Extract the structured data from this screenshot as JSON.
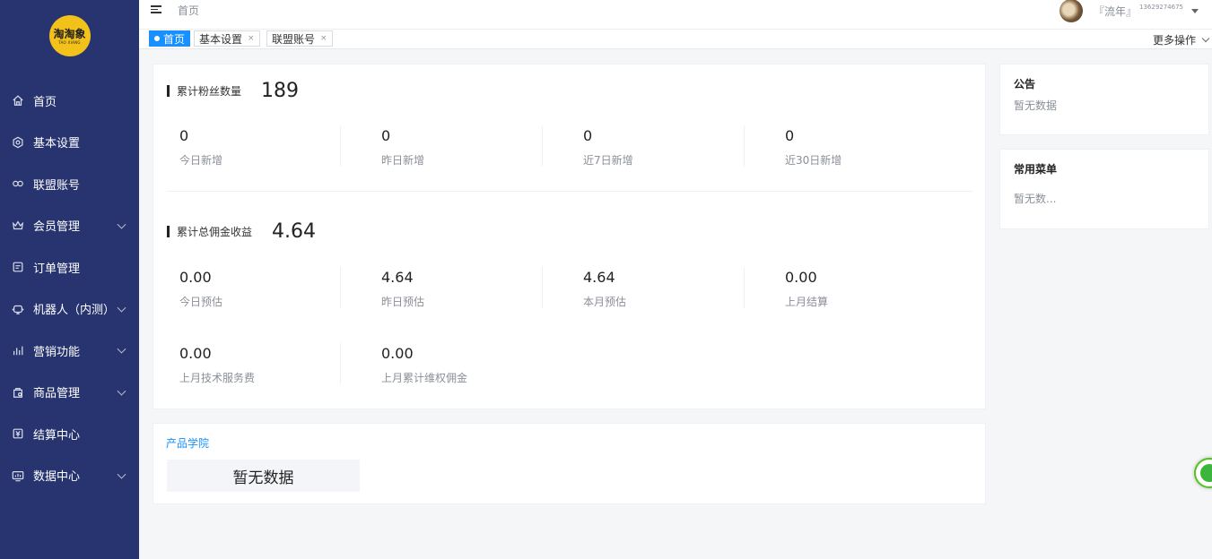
{
  "brand": {
    "logo_text": "淘淘象",
    "logo_sub": "TAO XIANG"
  },
  "sidebar": {
    "items": [
      {
        "label": "首页",
        "icon": "home-icon",
        "has_submenu": false
      },
      {
        "label": "基本设置",
        "icon": "settings-icon",
        "has_submenu": false
      },
      {
        "label": "联盟账号",
        "icon": "link-icon",
        "has_submenu": false
      },
      {
        "label": "会员管理",
        "icon": "crown-icon",
        "has_submenu": true
      },
      {
        "label": "订单管理",
        "icon": "order-icon",
        "has_submenu": false
      },
      {
        "label": "机器人（内测）",
        "icon": "robot-icon",
        "has_submenu": true
      },
      {
        "label": "营销功能",
        "icon": "chart-icon",
        "has_submenu": true
      },
      {
        "label": "商品管理",
        "icon": "goods-icon",
        "has_submenu": true
      },
      {
        "label": "结算中心",
        "icon": "settlement-icon",
        "has_submenu": false
      },
      {
        "label": "数据中心",
        "icon": "monitor-icon",
        "has_submenu": true
      }
    ],
    "colors": {
      "background": "#27346f",
      "text": "#ffffff"
    }
  },
  "topbar": {
    "breadcrumb": "首页",
    "user_name": "『流年』",
    "user_phone": "13629274675"
  },
  "tabs": {
    "items": [
      {
        "label": "首页",
        "active": true
      },
      {
        "label": "基本设置",
        "active": false,
        "close": "×"
      },
      {
        "label": "联盟账号",
        "active": false,
        "close": "×"
      }
    ],
    "more_ops": "更多操作",
    "active_color": "#1890ff"
  },
  "fans": {
    "title": "累计粉丝数量",
    "total": "189",
    "stats": [
      {
        "value": "0",
        "label": "今日新增"
      },
      {
        "value": "0",
        "label": "昨日新增"
      },
      {
        "value": "0",
        "label": "近7日新增"
      },
      {
        "value": "0",
        "label": "近30日新增"
      }
    ]
  },
  "commission": {
    "title": "累计总佣金收益",
    "total": "4.64",
    "stats": [
      {
        "value": "0.00",
        "label": "今日预估"
      },
      {
        "value": "4.64",
        "label": "昨日预估"
      },
      {
        "value": "4.64",
        "label": "本月预估"
      },
      {
        "value": "0.00",
        "label": "上月结算"
      },
      {
        "value": "0.00",
        "label": "上月技术服务费"
      },
      {
        "value": "0.00",
        "label": "上月累计维权佣金"
      }
    ]
  },
  "academy": {
    "title": "产品学院",
    "empty": "暂无数据"
  },
  "notice": {
    "title": "公告",
    "empty": "暂无数据"
  },
  "common_menu": {
    "title": "常用菜单",
    "empty": "暂无数..."
  }
}
